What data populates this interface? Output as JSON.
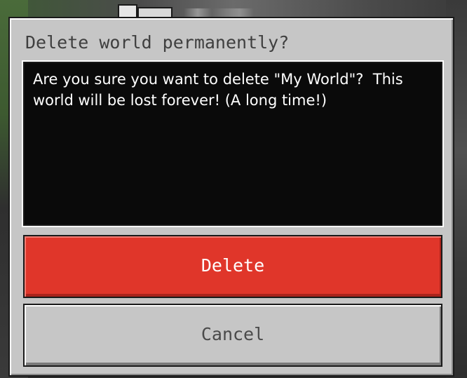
{
  "dialog": {
    "title": "Delete world permanently?",
    "message": "Are you sure you want to delete \"My World\"?  This world will be lost forever! (A long time!)",
    "delete_label": "Delete",
    "cancel_label": "Cancel"
  },
  "colors": {
    "dialog_background": "#c6c6c6",
    "message_background": "#0a0a0a",
    "delete_button": "#e0362a",
    "cancel_button": "#c6c6c6"
  }
}
